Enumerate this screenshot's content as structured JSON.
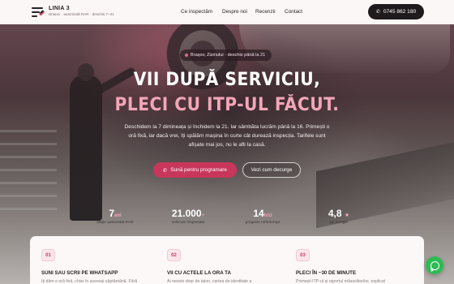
{
  "header": {
    "brand_name": "LINIA 3",
    "brand_sub": "Brașov · autorizată RAR · deschis 7–21",
    "nav": [
      "Ce inspectăm",
      "Despre noi",
      "Recenzii",
      "Contact"
    ],
    "phone": "0745 862 180"
  },
  "hero": {
    "pill": "Brașov, Zizinului · deschis până la 21",
    "title_line1": "VII DUPĂ SERVICIU,",
    "title_line2": "PLECI CU ITP-UL FĂCUT.",
    "description": "Deschidem la 7 dimineața și închidem la 21. Iar sâmbăta lucrăm până la 16. Primești o oră fixă, iar dacă vrei, îți spălăm mașina în curte cât durează inspecția. Tarifele sunt afișate mai jos, nu le afli la casă.",
    "primary_button": "Sună pentru programare",
    "secondary_button": "Vezi cum decurge"
  },
  "stats": [
    {
      "value": "7",
      "unit": "ani",
      "label": "stație autorizată RAR"
    },
    {
      "value": "21.000",
      "unit": "+",
      "label": "vehicule inspectate"
    },
    {
      "value": "14",
      "unit": "h/zi",
      "label": "program neîntrerupt"
    },
    {
      "value": "4,8",
      "unit": "★",
      "label": "pe Google"
    }
  ],
  "steps": [
    {
      "num": "01",
      "title": "SUNI SAU SCRII PE WHATSAPP",
      "text": "Îți dăm o oră fixă, chiar în aceeași săptămână. Fără"
    },
    {
      "num": "02",
      "title": "VII CU ACTELE LA ORA TA",
      "text": "Ai nevoie doar de talon, cartea de identitate a"
    },
    {
      "num": "03",
      "title": "PLECI ÎN ~30 DE MINUTE",
      "text": "Primești ITP-ul și raportul măsurătorilor, explicat"
    }
  ],
  "colors": {
    "accent": "#c8375b",
    "accent_light": "#f3a6b8",
    "whatsapp": "#2dbb55",
    "dark": "#1f1a1c"
  },
  "icons": {
    "phone": "phone-icon",
    "location": "location-dot-icon",
    "whatsapp": "whatsapp-icon",
    "logo": "checklist-logo-icon"
  }
}
